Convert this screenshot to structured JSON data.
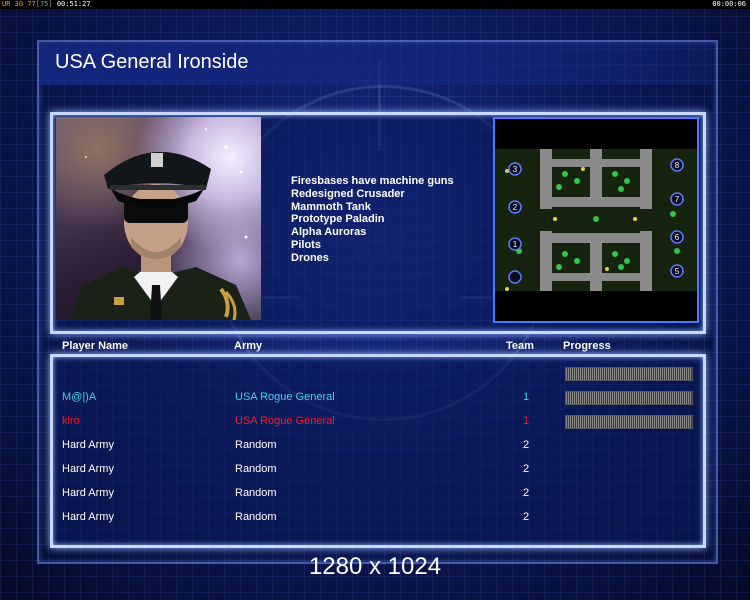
{
  "hud": {
    "left_label": "UR",
    "left_num1": "30",
    "left_num2": "77",
    "left_bracket": "[75]",
    "left_time": "00:51:27",
    "right_time": "00:00:06"
  },
  "title": "USA General Ironside",
  "features": [
    "Firesbases have machine guns",
    "Redesigned Crusader",
    "Mammoth Tank",
    "Prototype Paladin",
    "Alpha Auroras",
    "Pilots",
    "Drones"
  ],
  "minimap": {
    "slots": [
      "3",
      "2",
      "1",
      "",
      "8",
      "7",
      "6",
      "5"
    ]
  },
  "columns": {
    "player": "Player Name",
    "army": "Army",
    "team": "Team",
    "progress": "Progress"
  },
  "players": [
    {
      "name": "",
      "army": "",
      "team": "",
      "color": "#5a6aa0",
      "progress": 1.0
    },
    {
      "name": "M@|)A",
      "army": "USA Rogue General",
      "team": "1",
      "color": "#42d0e6",
      "progress": 1.0
    },
    {
      "name": "kiro",
      "army": "USA Rogue General",
      "team": "1",
      "color": "#ff1a1a",
      "progress": 1.0
    },
    {
      "name": "Hard Army",
      "army": "Random",
      "team": "2",
      "color": "#ffffff"
    },
    {
      "name": "Hard Army",
      "army": "Random",
      "team": "2",
      "color": "#ffffff"
    },
    {
      "name": "Hard Army",
      "army": "Random",
      "team": "2",
      "color": "#ffffff"
    },
    {
      "name": "Hard Army",
      "army": "Random",
      "team": "2",
      "color": "#ffffff"
    }
  ],
  "resolution": "1280 x 1024"
}
